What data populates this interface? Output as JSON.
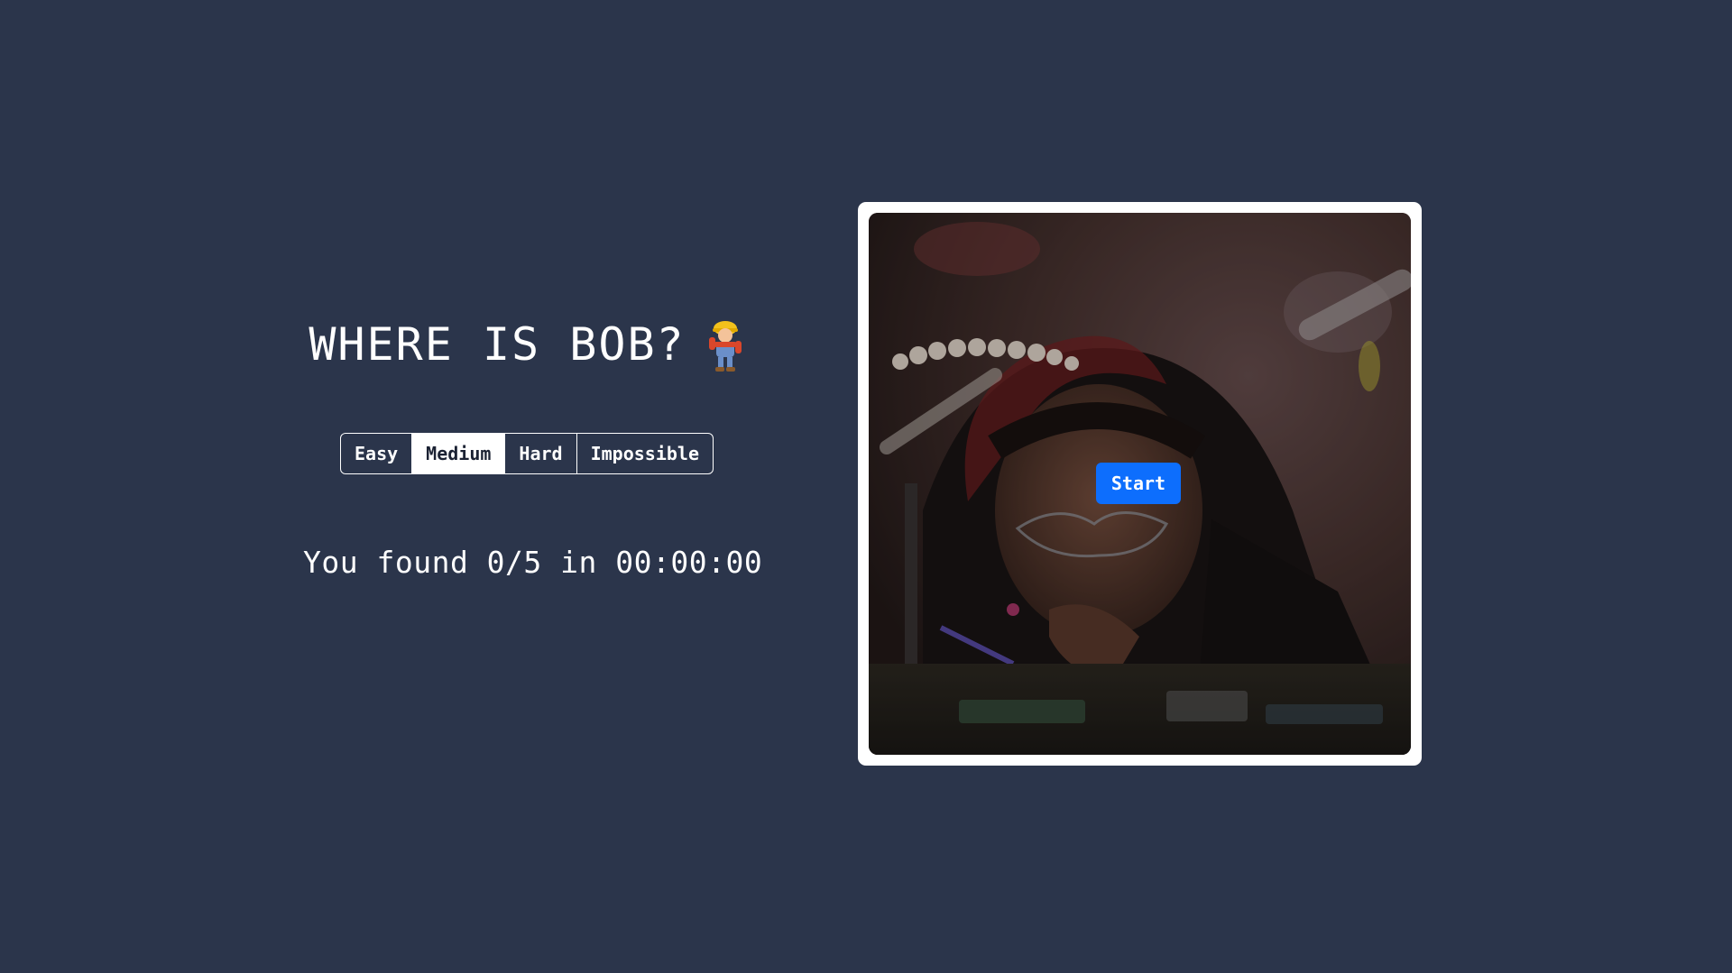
{
  "game": {
    "title": "WHERE IS BOB?",
    "title_icon": "bob-the-builder-icon"
  },
  "difficulty": {
    "options": [
      "Easy",
      "Medium",
      "Hard",
      "Impossible"
    ],
    "selected": "Medium"
  },
  "status": {
    "text": "You found 0/5 in 00:00:00",
    "found": 0,
    "total": 5,
    "time": "00:00:00"
  },
  "board": {
    "start_label": "Start",
    "image": "woman-soldering-photo"
  },
  "colors": {
    "background": "#2b354b",
    "accent": "#0d6efd",
    "frame": "#ffffff"
  }
}
